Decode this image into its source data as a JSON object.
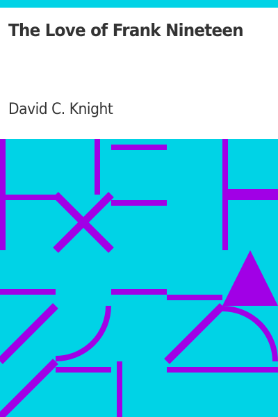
{
  "cover": {
    "title": "The Love of Frank Nineteen",
    "author": "David C. Knight"
  },
  "colors": {
    "band": "#00d3e6",
    "art_background": "#00d3e6",
    "shapes": "#a100e6",
    "text": "#333333",
    "page": "#ffffff"
  },
  "artwork": {
    "style": "geometric pattern",
    "motifs": [
      "lines",
      "x-cross",
      "triangle",
      "quarter-circle arcs",
      "diagonal stripes"
    ]
  }
}
